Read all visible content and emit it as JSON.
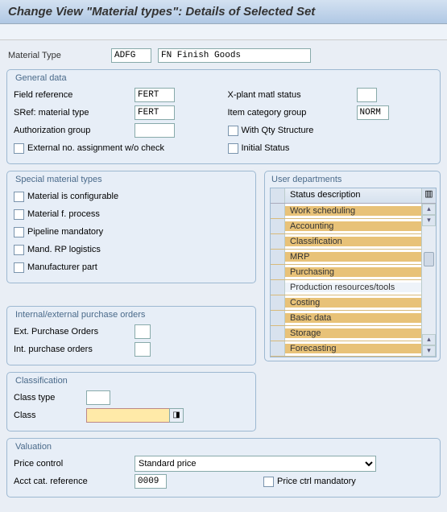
{
  "title": "Change View \"Material types\": Details of Selected Set",
  "top": {
    "materialTypeLabel": "Material Type",
    "materialTypeCode": "ADFG",
    "materialTypeDesc": "FN Finish Goods"
  },
  "general": {
    "title": "General data",
    "fieldRefLabel": "Field reference",
    "fieldRefVal": "FERT",
    "srefLabel": "SRef: material type",
    "srefVal": "FERT",
    "authLabel": "Authorization group",
    "authVal": "",
    "extNoLabel": "External no. assignment w/o check",
    "xplantLabel": "X-plant matl status",
    "xplantVal": "",
    "itemCatLabel": "Item category group",
    "itemCatVal": "NORM",
    "withQtyLabel": "With Qty Structure",
    "initStatusLabel": "Initial Status"
  },
  "special": {
    "title": "Special material types",
    "items": [
      "Material is configurable",
      "Material f. process",
      "Pipeline mandatory",
      "Mand. RP logistics",
      "Manufacturer part"
    ]
  },
  "userDept": {
    "title": "User departments",
    "header": "Status description",
    "rows": [
      {
        "label": "Work scheduling",
        "sel": true
      },
      {
        "label": "Accounting",
        "sel": true
      },
      {
        "label": "Classification",
        "sel": true
      },
      {
        "label": "MRP",
        "sel": true
      },
      {
        "label": "Purchasing",
        "sel": true
      },
      {
        "label": "Production resources/tools",
        "sel": false
      },
      {
        "label": "Costing",
        "sel": true
      },
      {
        "label": "Basic data",
        "sel": true
      },
      {
        "label": "Storage",
        "sel": true
      },
      {
        "label": "Forecasting",
        "sel": true
      }
    ]
  },
  "iep": {
    "title": "Internal/external purchase orders",
    "extLabel": "Ext. Purchase Orders",
    "intLabel": "Int. purchase orders"
  },
  "classif": {
    "title": "Classification",
    "classTypeLabel": "Class type",
    "classLabel": "Class"
  },
  "valuation": {
    "title": "Valuation",
    "priceCtrlLabel": "Price control",
    "priceCtrlVal": "Standard price",
    "acctLabel": "Acct cat. reference",
    "acctVal": "0009",
    "priceMandLabel": "Price ctrl mandatory"
  }
}
